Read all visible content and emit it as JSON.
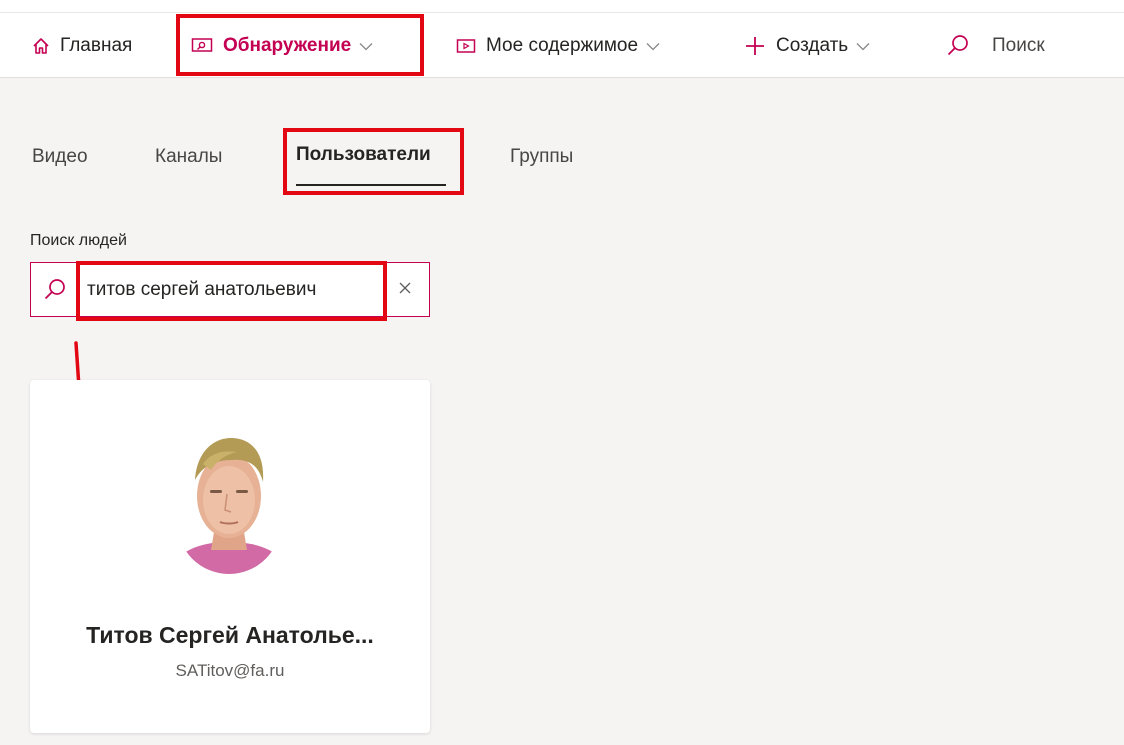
{
  "nav": {
    "home": "Главная",
    "discover": "Обнаружение",
    "my_content": "Мое содержимое",
    "create": "Создать",
    "search": "Поиск"
  },
  "tabs": [
    {
      "label": "Видео"
    },
    {
      "label": "Каналы"
    },
    {
      "label": "Пользователи",
      "active": true
    },
    {
      "label": "Группы"
    }
  ],
  "people_search": {
    "label": "Поиск людей",
    "value": "титов сергей анатольевич"
  },
  "result_card": {
    "name": "Титов Сергей Анатолье...",
    "email": "SATitov@fa.ru"
  },
  "colors": {
    "accent": "#c30052",
    "annotation": "#e30613"
  },
  "icons": [
    "home-icon",
    "discover-icon",
    "chevron-down-icon",
    "video-icon",
    "plus-icon",
    "search-icon",
    "close-icon"
  ]
}
